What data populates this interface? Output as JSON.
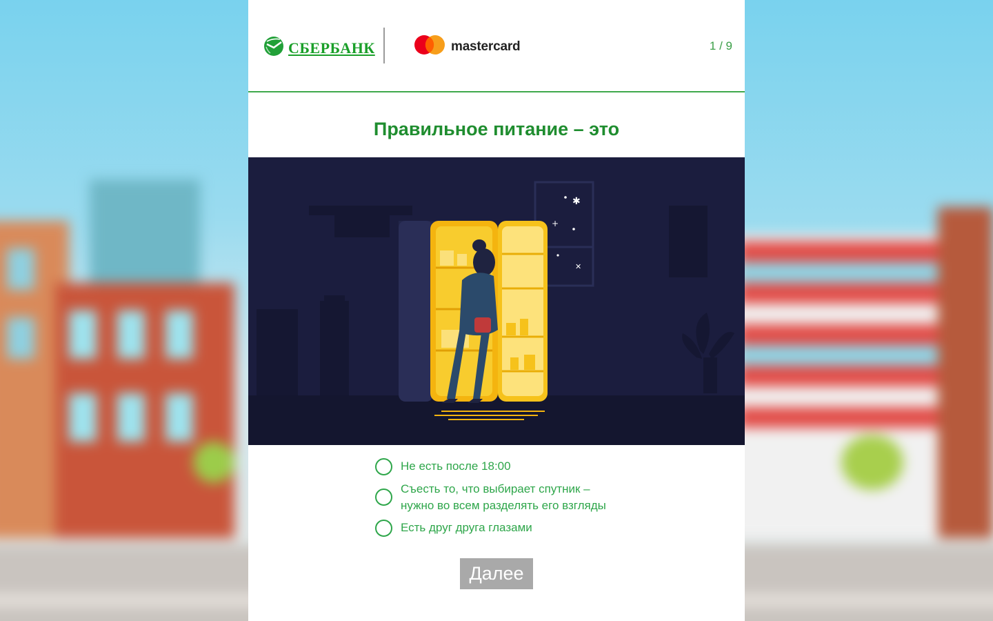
{
  "header": {
    "sber_logo_text": "СБЕРБАНК",
    "mastercard_text": "mastercard",
    "counter": "1 / 9"
  },
  "question": {
    "title": "Правильное питание – это"
  },
  "answers": [
    {
      "text": "Не есть после 18:00"
    },
    {
      "text": "Съесть то, что выбирает спутник –\nнужно во всем разделять его взгляды"
    },
    {
      "text": "Есть друг друга глазами"
    }
  ],
  "next_label": "Далее",
  "colors": {
    "brand_green": "#1f8d2f",
    "scene_bg": "#1b1d3e",
    "fridge_light": "#f6c21b",
    "button_grey": "#a9a9a9"
  }
}
